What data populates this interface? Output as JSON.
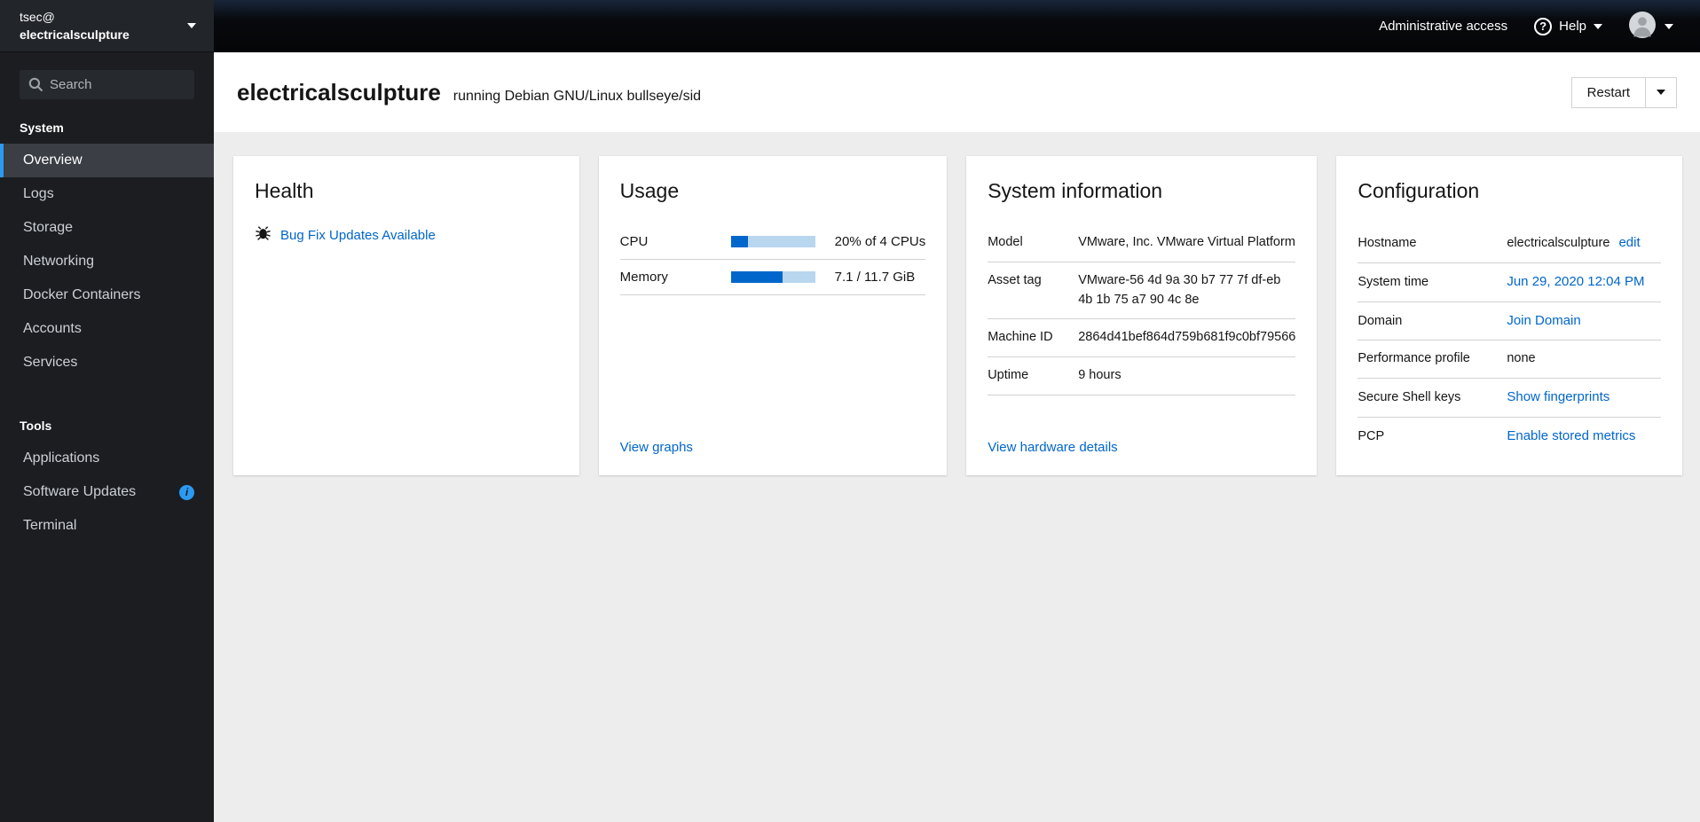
{
  "colors": {
    "accent_link": "#0066cc",
    "nav_selected_indicator": "#2b9af3",
    "info_badge": "#2b9af3",
    "progress_fill": "#0066cc",
    "progress_track": "#b9d6ef"
  },
  "icons": {
    "help_glyph": "?",
    "info_badge_glyph": "i"
  },
  "sidebar": {
    "user": "tsec@",
    "host": "electricalsculpture",
    "search_placeholder": "Search",
    "sections": [
      {
        "title": "System",
        "items": [
          {
            "label": "Overview",
            "current": true
          },
          {
            "label": "Logs"
          },
          {
            "label": "Storage"
          },
          {
            "label": "Networking"
          },
          {
            "label": "Docker Containers"
          },
          {
            "label": "Accounts"
          },
          {
            "label": "Services"
          }
        ]
      },
      {
        "title": "Tools",
        "items": [
          {
            "label": "Applications"
          },
          {
            "label": "Software Updates",
            "badge": "info"
          },
          {
            "label": "Terminal"
          }
        ]
      }
    ]
  },
  "masthead": {
    "admin_access": "Administrative access",
    "help": "Help"
  },
  "header": {
    "hostname": "electricalsculpture",
    "subtitle": "running Debian GNU/Linux bullseye/sid",
    "restart": "Restart"
  },
  "health": {
    "title": "Health",
    "update_link": "Bug Fix Updates Available"
  },
  "usage": {
    "title": "Usage",
    "rows": [
      {
        "label": "CPU",
        "percent": 20,
        "value": "20% of 4 CPUs"
      },
      {
        "label": "Memory",
        "percent": 61,
        "value": "7.1 / 11.7 GiB"
      }
    ],
    "footer_link": "View graphs"
  },
  "sysinfo": {
    "title": "System information",
    "rows": [
      {
        "label": "Model",
        "value": "VMware, Inc. VMware Virtual Platform"
      },
      {
        "label": "Asset tag",
        "value": "VMware-56 4d 9a 30 b7 77 7f df-eb 4b 1b 75 a7 90 4c 8e"
      },
      {
        "label": "Machine ID",
        "value": "2864d41bef864d759b681f9c0bf79566"
      },
      {
        "label": "Uptime",
        "value": "9 hours"
      }
    ],
    "footer_link": "View hardware details"
  },
  "config": {
    "title": "Configuration",
    "hostname_label": "Hostname",
    "hostname_value": "electricalsculpture",
    "hostname_edit": "edit",
    "system_time_label": "System time",
    "system_time_link": "Jun 29, 2020 12:04 PM",
    "domain_label": "Domain",
    "domain_link": "Join Domain",
    "perf_label": "Performance profile",
    "perf_value": "none",
    "ssh_label": "Secure Shell keys",
    "ssh_link": "Show fingerprints",
    "pcp_label": "PCP",
    "pcp_link": "Enable stored metrics"
  }
}
